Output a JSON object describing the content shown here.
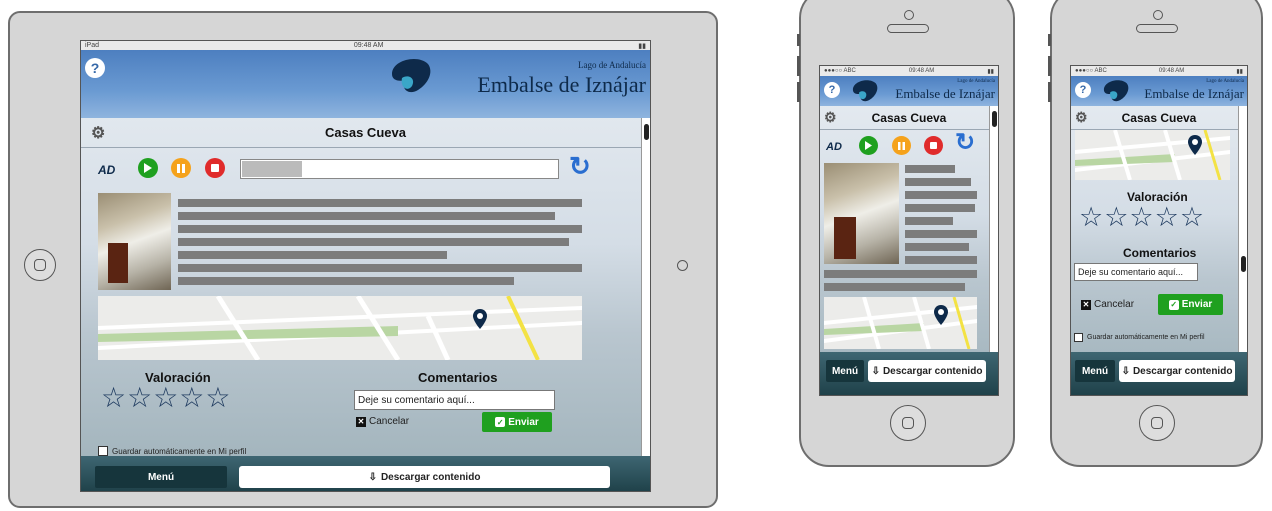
{
  "status_tablet": {
    "carrier": "iPad",
    "time": "09:48 AM"
  },
  "status_phone": {
    "carrier": "●●●○○ ABC",
    "time": "09:48 AM"
  },
  "header": {
    "help": "?",
    "subtitle": "Lago de Andalucía",
    "title": "Embalse de Iznájar"
  },
  "page": {
    "title": "Casas Cueva"
  },
  "player": {
    "ad_label": "AD",
    "progress": 0.2
  },
  "rating": {
    "label": "Valoración",
    "stars": "☆☆☆☆☆",
    "value": 0,
    "max": 5
  },
  "comments": {
    "label": "Comentarios",
    "placeholder": "Deje su comentario aquí..."
  },
  "actions": {
    "cancel": "Cancelar",
    "send": "Enviar"
  },
  "save_profile": {
    "label": "Guardar automáticamente en Mi perfil"
  },
  "footer": {
    "menu": "Menú",
    "download": "Descargar contenido"
  },
  "colors": {
    "header": "#5a8ccb",
    "play": "#1fa01f",
    "pause": "#f5a21b",
    "stop": "#e02b2b",
    "send": "#1fa01f",
    "footer": "#1e4048"
  }
}
